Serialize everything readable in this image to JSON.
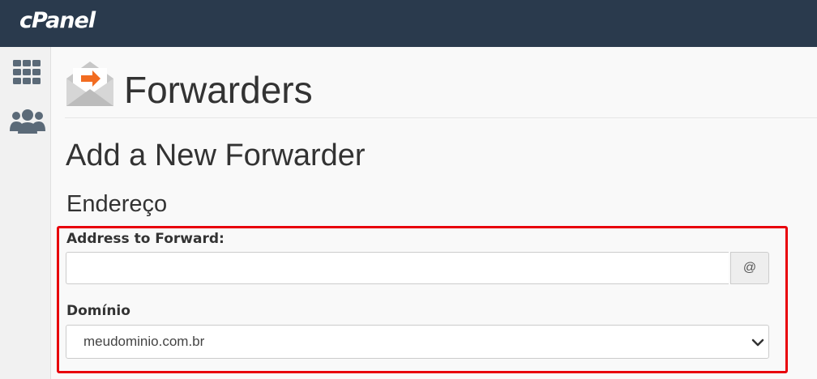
{
  "topbar": {
    "logo_text": "cPanel",
    "bg_color": "#2a3a4d"
  },
  "sidebar": {
    "items": [
      {
        "icon": "grid-icon"
      },
      {
        "icon": "users-icon"
      }
    ]
  },
  "page": {
    "icon": "email-forward-icon",
    "title": "Forwarders",
    "section_title": "Add a New Forwarder",
    "subsection_title": "Endereço"
  },
  "form": {
    "address_label": "Address to Forward:",
    "address_value": "",
    "address_addon": "@",
    "domain_label": "Domínio",
    "domain_selected": "meudominio.com.br"
  },
  "colors": {
    "highlight": "#e8000b",
    "accent": "#f26c21"
  }
}
